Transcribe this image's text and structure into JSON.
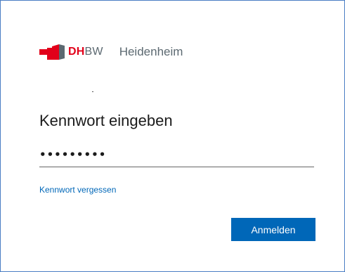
{
  "logo": {
    "brand_red": "DH",
    "brand_gray": "BW",
    "location": "Heidenheim"
  },
  "title": "Kennwort eingeben",
  "password": {
    "value": "•••••••••"
  },
  "forgot_link": "Kennwort vergessen",
  "signin_button": "Anmelden",
  "colors": {
    "accent": "#0067b8",
    "brand_red": "#e2001a",
    "brand_gray": "#5c6971",
    "frame_border": "#4a7ec4"
  }
}
